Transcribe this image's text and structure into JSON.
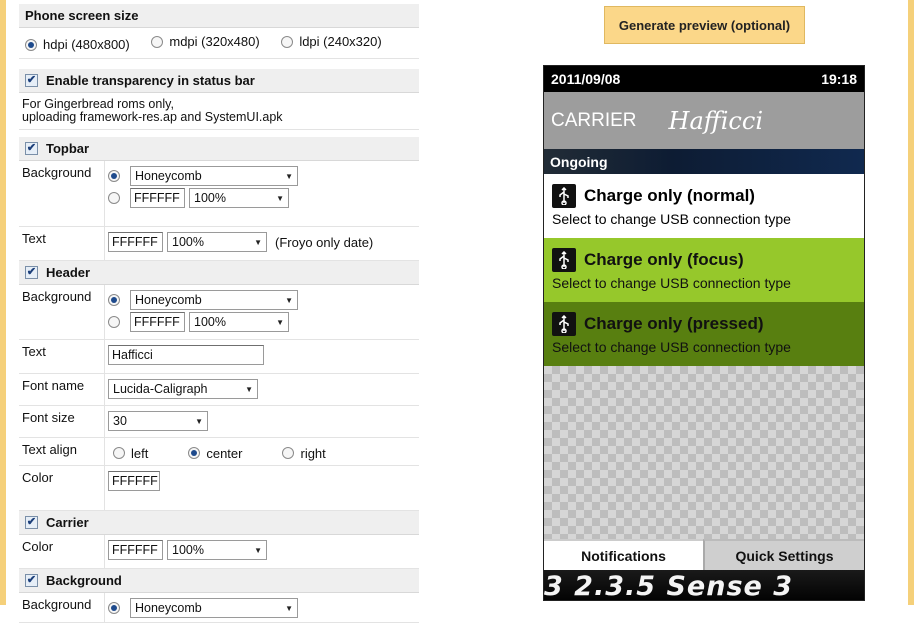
{
  "form": {
    "screen_size": {
      "title": "Phone screen size",
      "options": [
        "hdpi (480x800)",
        "mdpi (320x480)",
        "ldpi (240x320)"
      ],
      "selected": 0
    },
    "transparency": {
      "title": "Enable transparency in status bar",
      "checked": true,
      "note_line1": "For Gingerbread roms only,",
      "note_line2": "uploading framework-res.ap and SystemUI.apk"
    },
    "topbar": {
      "title": "Topbar",
      "background_label": "Background",
      "bg_preset": "Honeycomb",
      "bg_color": "FFFFFF",
      "bg_opacity": "100%",
      "text_label": "Text",
      "text_color": "FFFFFF",
      "text_opacity": "100%",
      "text_note": "(Froyo only date)"
    },
    "header": {
      "title": "Header",
      "background_label": "Background",
      "bg_preset": "Honeycomb",
      "bg_color": "FFFFFF",
      "bg_opacity": "100%",
      "text_label": "Text",
      "text_value": "Hafficci",
      "font_name_label": "Font name",
      "font_name": "Lucida-Caligraph",
      "font_size_label": "Font size",
      "font_size": "30",
      "align_label": "Text align",
      "align_options": [
        "left",
        "center",
        "right"
      ],
      "align_selected": 1,
      "color_label": "Color",
      "color_value": "FFFFFF"
    },
    "carrier": {
      "title": "Carrier",
      "color_label": "Color",
      "color_value": "FFFFFF",
      "opacity": "100%"
    },
    "background": {
      "title": "Background",
      "background_label": "Background",
      "bg_preset": "Honeycomb"
    }
  },
  "generate_button": "Generate preview (optional)",
  "preview": {
    "date": "2011/09/08",
    "time": "19:18",
    "carrier": "CARRIER",
    "header_text": "Hafficci",
    "ongoing": "Ongoing",
    "notifications": [
      {
        "title": "Charge only (normal)",
        "subtitle": "Select to change USB connection type"
      },
      {
        "title": "Charge only (focus)",
        "subtitle": "Select to change USB connection type"
      },
      {
        "title": "Charge only (pressed)",
        "subtitle": "Select to change USB connection type"
      }
    ],
    "tabs": [
      "Notifications",
      "Quick Settings"
    ],
    "banner": "3 2.3.5 Sense 3"
  },
  "colors": {
    "accent_button": "#fbd789",
    "focus_green": "#96c82b",
    "pressed_green": "#587f10"
  }
}
